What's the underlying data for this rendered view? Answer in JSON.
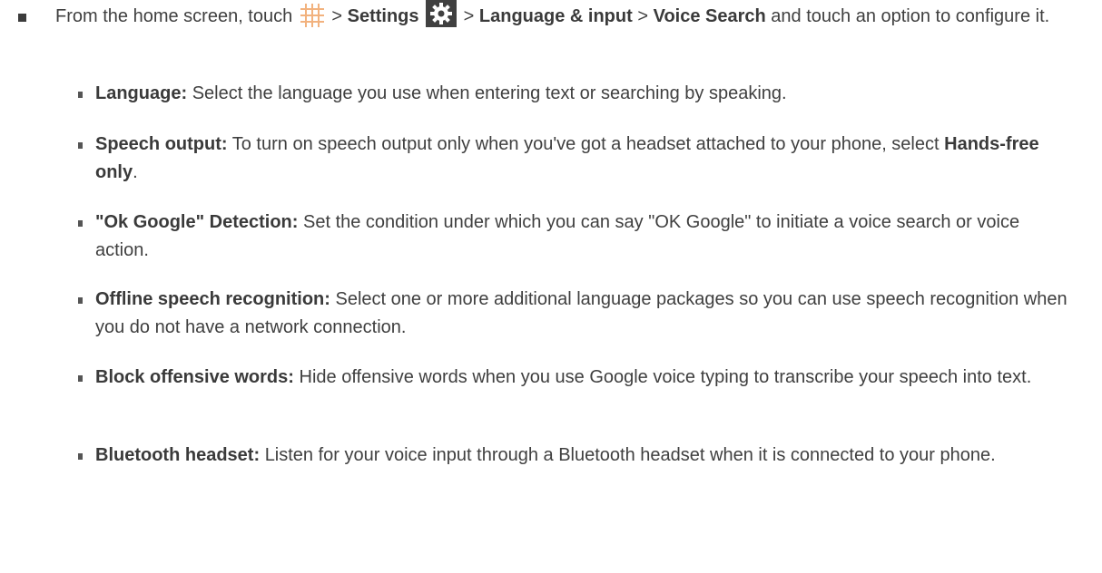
{
  "main_step": {
    "part1": "From the home screen, touch",
    "sep1": ">",
    "settings": "Settings",
    "sep2": ">",
    "language_input": "Language & input",
    "sep3": ">",
    "voice_search": "Voice Search",
    "part2": "and touch an option to configure it."
  },
  "options": [
    {
      "term": "Language:",
      "desc": "Select the language you use when entering text or searching by speaking."
    },
    {
      "term": "Speech output:",
      "desc": "To turn on speech output only when you've got a headset attached to your phone, select",
      "emph": "Hands-free only",
      "end": "."
    },
    {
      "term": "\"Ok Google\" Detection:",
      "desc": "Set the condition under which you can say \"OK Google\" to initiate a voice search or voice action."
    },
    {
      "term": "Offline speech recognition:",
      "desc": "Select one or more additional language packages so you can use speech recognition when you do not have a network connection."
    },
    {
      "term": "Block offensive words:",
      "desc": "Hide offensive words when you use Google voice typing to transcribe your speech into text."
    },
    {
      "term": "Bluetooth headset:",
      "desc": "Listen for your voice input through a Bluetooth headset when it is connected to your phone."
    }
  ]
}
